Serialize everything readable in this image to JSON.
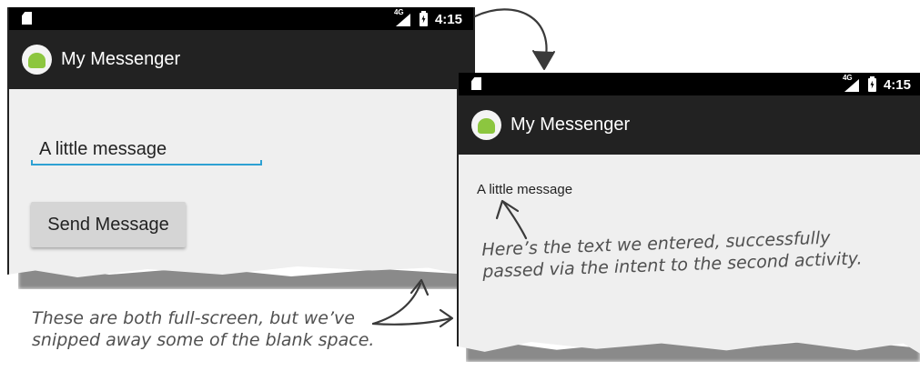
{
  "screen_first": {
    "status_bar": {
      "network": "4G",
      "time": "4:15",
      "icons": [
        "sim-card-icon",
        "signal-icon",
        "battery-charging-icon"
      ]
    },
    "action_bar": {
      "app_icon": "android-icon",
      "title": "My Messenger"
    },
    "message_input": {
      "value": "A little message"
    },
    "send_button": {
      "label": "Send Message"
    }
  },
  "screen_second": {
    "status_bar": {
      "network": "4G",
      "time": "4:15",
      "icons": [
        "sim-card-icon",
        "signal-icon",
        "battery-charging-icon"
      ]
    },
    "action_bar": {
      "app_icon": "android-icon",
      "title": "My Messenger"
    },
    "received_message": "A little message"
  },
  "annotations": {
    "received_note": {
      "line1": "Here’s the text we entered, successfully",
      "line2": "passed via the intent to the second activity."
    },
    "snipped_note": {
      "line1": "These are both full-screen, but we’ve",
      "line2": "snipped away some of the blank space."
    }
  },
  "colors": {
    "status_bar": "#000000",
    "action_bar": "#222222",
    "screen_background": "#efefef",
    "input_underline": "#2ea1d3",
    "button": "#d5d5d5",
    "android_green": "#8cc63f",
    "annotation_ink": "#505050"
  }
}
